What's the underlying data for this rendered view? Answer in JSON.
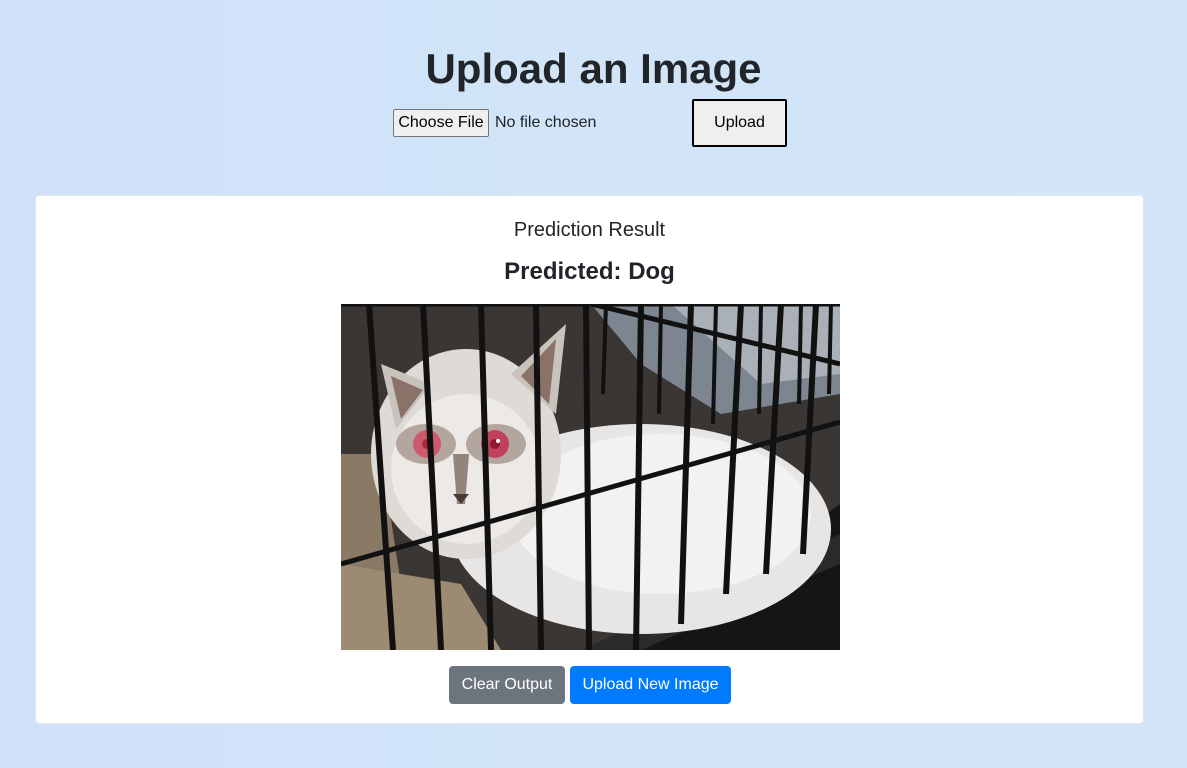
{
  "header": {
    "title": "Upload an Image"
  },
  "upload_form": {
    "file_button_label": "Choose File",
    "file_status": "No file chosen",
    "upload_label": "Upload"
  },
  "result": {
    "heading": "Prediction Result",
    "prediction": "Predicted: Dog",
    "image_alt": "Uploaded photo of a white cat inside a wire cage"
  },
  "actions": {
    "clear_label": "Clear Output",
    "new_image_label": "Upload New Image"
  },
  "colors": {
    "background": "#cfe2f9",
    "card": "#ffffff",
    "clear_button": "#6c757d",
    "new_image_button": "#007bff"
  }
}
